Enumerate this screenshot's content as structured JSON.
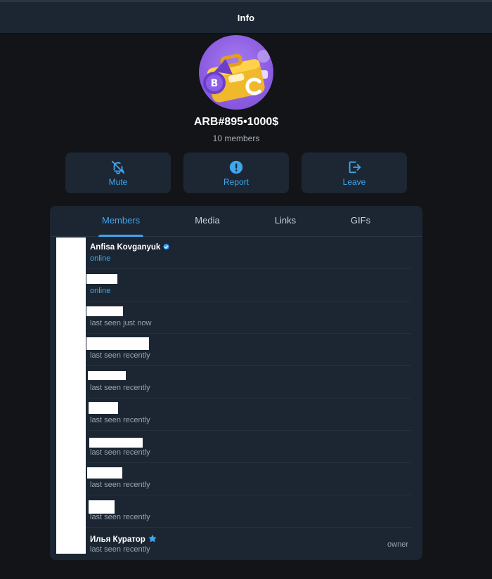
{
  "header": {
    "title": "Info"
  },
  "group": {
    "name": "ARB#895•1000$",
    "members_count_text": "10 members"
  },
  "actions": {
    "mute": {
      "label": "Mute",
      "icon": "bell-off-icon"
    },
    "report": {
      "label": "Report",
      "icon": "alert-circle-icon"
    },
    "leave": {
      "label": "Leave",
      "icon": "logout-icon"
    }
  },
  "tabs": [
    {
      "label": "Members",
      "active": true
    },
    {
      "label": "Media",
      "active": false
    },
    {
      "label": "Links",
      "active": false
    },
    {
      "label": "GIFs",
      "active": false
    }
  ],
  "members": [
    {
      "name": "Anfisa Kovganyuk",
      "status": "online",
      "badge": "verified-icon",
      "role": ""
    },
    {
      "name": "",
      "status": "online",
      "badge": "",
      "role": ""
    },
    {
      "name": "",
      "status": "last seen just now",
      "badge": "",
      "role": ""
    },
    {
      "name": "",
      "status": "last seen recently",
      "badge": "",
      "role": ""
    },
    {
      "name": "",
      "status": "last seen recently",
      "badge": "",
      "role": ""
    },
    {
      "name": "",
      "status": "last seen recently",
      "badge": "",
      "role": ""
    },
    {
      "name": "",
      "status": "last seen recently",
      "badge": "",
      "role": ""
    },
    {
      "name": "",
      "status": "last seen recently",
      "badge": "",
      "role": ""
    },
    {
      "name": "",
      "status": "last seen recently",
      "badge": "",
      "role": ""
    },
    {
      "name": "Илья Куратор",
      "status": "last seen recently",
      "badge": "star-icon",
      "role": "owner"
    }
  ],
  "colors": {
    "accent": "#3ea6f0",
    "background": "#121417",
    "panel": "#1c2632",
    "topbar": "#1b2632"
  }
}
